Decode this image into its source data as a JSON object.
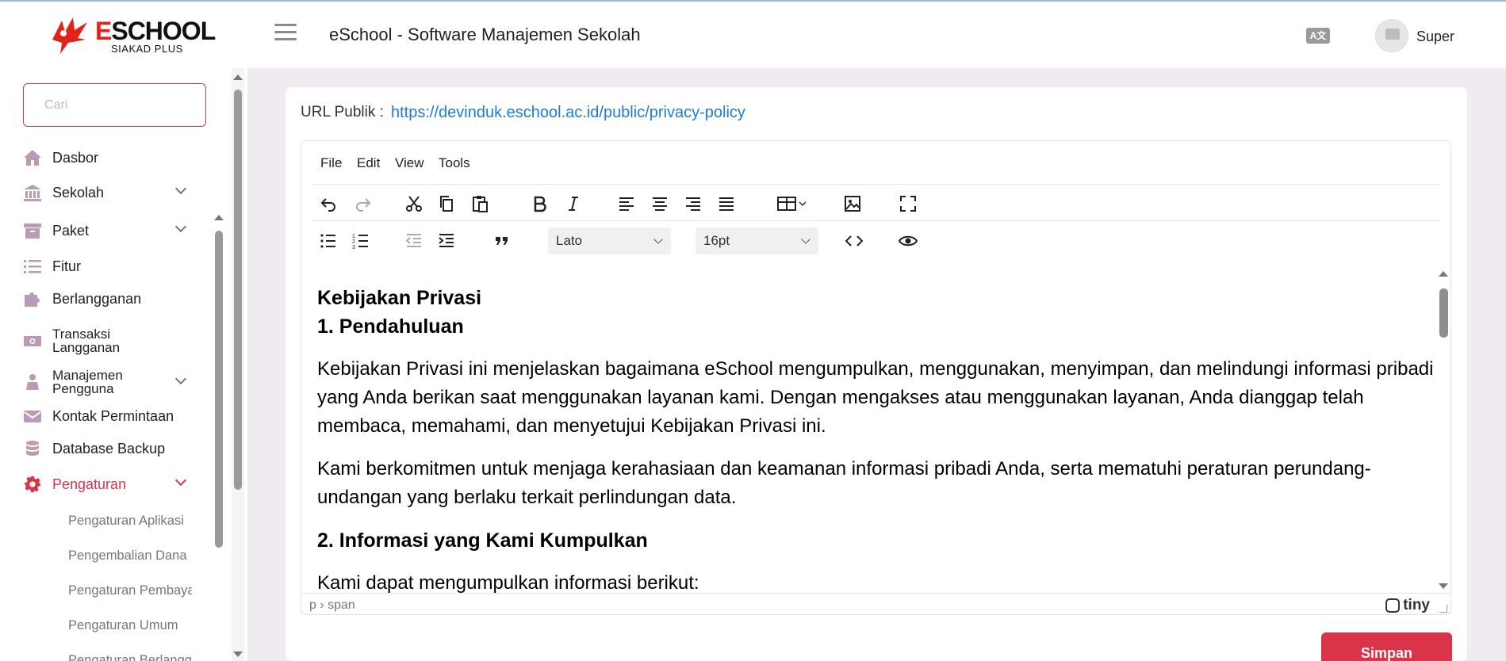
{
  "header": {
    "logo_text_first": "E",
    "logo_text_rest": "SCHOOL",
    "logo_sub": "SIAKAD PLUS",
    "title": "eSchool - Software Manajemen Sekolah",
    "lang_icon": "A文",
    "user_name": "Super"
  },
  "sidebar": {
    "search_placeholder": "Cari",
    "items": [
      {
        "label": "Dasbor",
        "icon": "home-icon"
      },
      {
        "label": "Sekolah",
        "icon": "bank-icon",
        "expandable": true
      },
      {
        "label": "Paket",
        "icon": "archive-icon",
        "expandable": true
      },
      {
        "label": "Fitur",
        "icon": "list-icon"
      },
      {
        "label": "Berlangganan",
        "icon": "puzzle-icon"
      },
      {
        "label_line1": "Transaksi",
        "label_line2": "Langganan",
        "icon": "money-icon"
      },
      {
        "label_line1": "Manajemen",
        "label_line2": "Pengguna",
        "icon": "user-group-icon",
        "expandable": true
      },
      {
        "label": "Kontak Permintaan",
        "icon": "envelope-icon"
      },
      {
        "label": "Database Backup",
        "icon": "database-icon"
      },
      {
        "label": "Pengaturan",
        "icon": "gear-icon",
        "expandable": true,
        "active": true
      }
    ],
    "sub_items": [
      "Pengaturan Aplikasi",
      "Pengembalian Dana",
      "Pengaturan Pembayaran",
      "Pengaturan Umum",
      "Pengaturan Berlangganan"
    ]
  },
  "main": {
    "url_label": "URL Publik :",
    "url_value": "https://devinduk.eschool.ac.id/public/privacy-policy",
    "editor": {
      "menu": [
        "File",
        "Edit",
        "View",
        "Tools"
      ],
      "font_family": "Lato",
      "font_size": "16pt",
      "content": {
        "heading1": "Kebijakan Privasi",
        "heading2": "1. Pendahuluan",
        "para1": "Kebijakan Privasi ini menjelaskan bagaimana eSchool mengumpulkan, menggunakan, menyimpan, dan melindungi informasi pribadi yang Anda berikan saat menggunakan layanan kami. Dengan mengakses atau menggunakan layanan, Anda dianggap telah membaca, memahami, dan menyetujui Kebijakan Privasi ini.",
        "para2": "Kami berkomitmen untuk menjaga kerahasiaan dan keamanan informasi pribadi Anda, serta mematuhi peraturan perundang-undangan yang berlaku terkait perlindungan data.",
        "heading3": "2. Informasi yang Kami Kumpulkan",
        "para3": "Kami dapat mengumpulkan informasi berikut:"
      },
      "status_path": "p › span",
      "brand": "tiny"
    },
    "save_label": "Simpan"
  },
  "colors": {
    "accent": "#d9344a",
    "link": "#1c7cd6",
    "background": "#f0eaf1",
    "sidebar_icon": "#b99bb6"
  }
}
